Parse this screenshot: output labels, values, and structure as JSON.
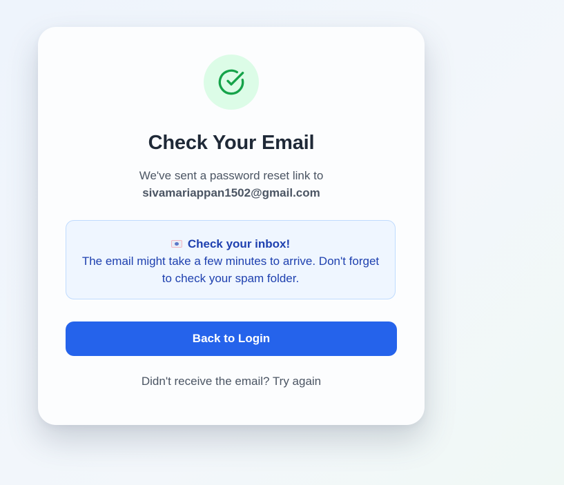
{
  "card": {
    "title": "Check Your Email",
    "subtitle": "We've sent a password reset link to",
    "email": "sivamariappan1502@gmail.com",
    "success_icon": "check-circle-icon",
    "success_color": "#16a34a"
  },
  "notice": {
    "icon": "email-icon",
    "heading": "Check your inbox!",
    "body": "The email might take a few minutes to arrive. Don't forget to check your spam folder."
  },
  "actions": {
    "back_label": "Back to Login",
    "resend_prompt": "Didn't receive the email?",
    "resend_link": "Try again"
  },
  "colors": {
    "accent": "#2563eb",
    "success_bg": "#dcfce7",
    "notice_bg": "#eff6ff",
    "notice_text": "#1e40af"
  }
}
